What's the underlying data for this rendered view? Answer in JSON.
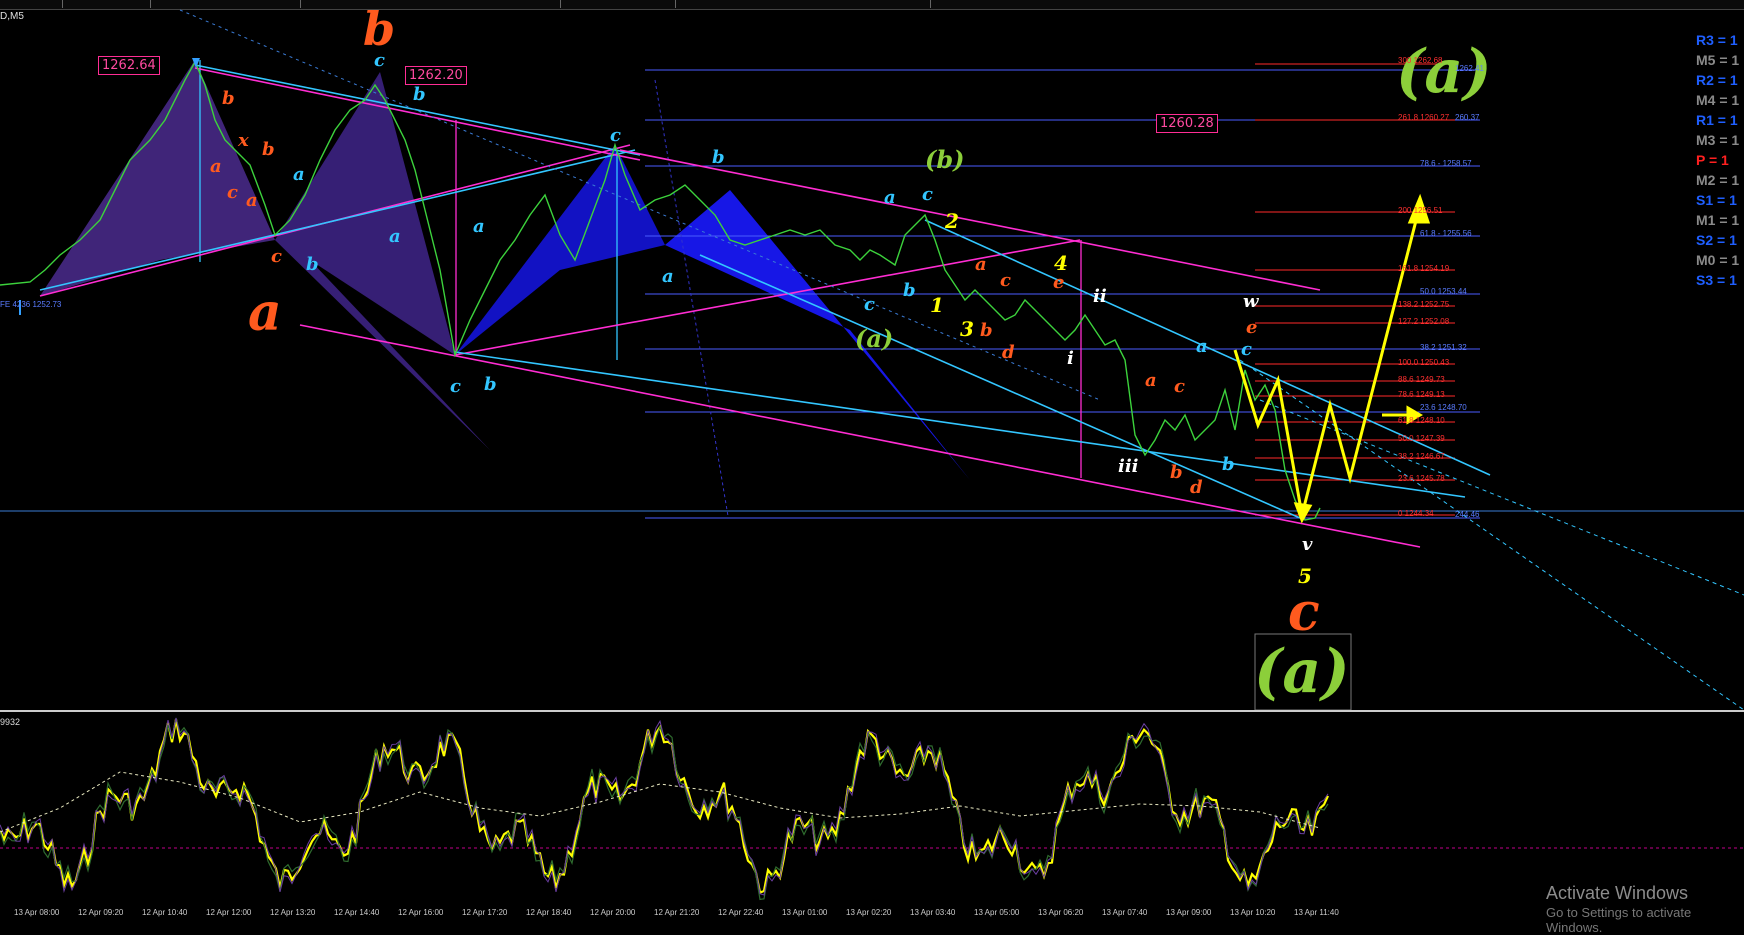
{
  "chart_title": "D,M5",
  "pivots": [
    {
      "label": "R3 = 1",
      "color": "#1f5fff"
    },
    {
      "label": "M5 = 1",
      "color": "#8a8a8a"
    },
    {
      "label": "R2 = 1",
      "color": "#1f5fff"
    },
    {
      "label": "M4 = 1",
      "color": "#8a8a8a"
    },
    {
      "label": "R1 = 1",
      "color": "#1f5fff"
    },
    {
      "label": "M3 = 1",
      "color": "#8a8a8a"
    },
    {
      "label": "P = 1",
      "color": "#ff2020"
    },
    {
      "label": "M2 = 1",
      "color": "#8a8a8a"
    },
    {
      "label": "S1 = 1",
      "color": "#1f5fff"
    },
    {
      "label": "M1 = 1",
      "color": "#8a8a8a"
    },
    {
      "label": "S2 = 1",
      "color": "#1f5fff"
    },
    {
      "label": "M0 = 1",
      "color": "#8a8a8a"
    },
    {
      "label": "S3 = 1",
      "color": "#1f5fff"
    }
  ],
  "price_boxes": {
    "high_left": "1262.64",
    "high_mid": "1262.20",
    "target": "1260.28"
  },
  "fe_label": "FE 4236 1252.73",
  "fib_blue": [
    {
      "text": "1262.41",
      "color": "#5a7cff"
    },
    {
      "text": "260.37",
      "color": "#5a7cff"
    },
    {
      "text": "78.6 - 1258.57",
      "color": "#5a7cff"
    },
    {
      "text": "61.8 - 1255.56",
      "color": "#5a7cff"
    },
    {
      "text": "50.0 1253.44",
      "color": "#5a7cff"
    },
    {
      "text": "38.2 1251.32",
      "color": "#5a7cff"
    },
    {
      "text": "23.6 1248.70",
      "color": "#5a7cff"
    },
    {
      "text": "244.46",
      "color": "#5a7cff"
    }
  ],
  "fib_red": [
    {
      "text": "300 1262.68",
      "color": "#ff3030"
    },
    {
      "text": "261.8 1260.27",
      "color": "#ff3030"
    },
    {
      "text": "200 1256.51",
      "color": "#ff3030"
    },
    {
      "text": "161.8 1254.19",
      "color": "#ff3030"
    },
    {
      "text": "138.2 1252.75",
      "color": "#ff3030"
    },
    {
      "text": "127.2 1252.08",
      "color": "#ff3030"
    },
    {
      "text": "100.0 1250.43",
      "color": "#ff3030"
    },
    {
      "text": "88.6 1249.73",
      "color": "#ff3030"
    },
    {
      "text": "78.6 1249.13",
      "color": "#ff3030"
    },
    {
      "text": "61.8 1248.10",
      "color": "#ff3030"
    },
    {
      "text": "50.0 1247.39",
      "color": "#ff3030"
    },
    {
      "text": "38.2 1246.67",
      "color": "#ff3030"
    },
    {
      "text": "23.6 1245.78",
      "color": "#ff3030"
    },
    {
      "text": "0 1244.34",
      "color": "#ff3030"
    }
  ],
  "wave_labels": {
    "big_b": "b",
    "big_a": "a",
    "big_c": "c",
    "circ_a_top": "(a)",
    "circ_a_bottom": "(a)",
    "circ_b": "(b)",
    "sub_a": "(a)",
    "n1": "1",
    "n2": "2",
    "n3": "3",
    "n4": "4",
    "n5": "5",
    "r_i": "i",
    "r_ii": "ii",
    "r_iii": "iii",
    "r_w": "w",
    "r_v": "v",
    "a": "a",
    "b": "b",
    "c": "c",
    "d": "d",
    "e": "e",
    "x": "x"
  },
  "indicator_label": "9932",
  "time_labels": [
    "13 Apr 08:00",
    "12 Apr 09:20",
    "12 Apr 10:40",
    "12 Apr 12:00",
    "12 Apr 13:20",
    "12 Apr 14:40",
    "12 Apr 16:00",
    "12 Apr 17:20",
    "12 Apr 18:40",
    "12 Apr 20:00",
    "12 Apr 21:20",
    "12 Apr 22:40",
    "13 Apr 01:00",
    "13 Apr 02:20",
    "13 Apr 03:40",
    "13 Apr 05:00",
    "13 Apr 06:20",
    "13 Apr 07:40",
    "13 Apr 09:00",
    "13 Apr 10:20",
    "13 Apr 11:40"
  ],
  "watermark": {
    "title": "Activate Windows",
    "subtitle": "Go to Settings to activate Windows."
  },
  "colors": {
    "price": "#3cd23c",
    "oscillator": "#ffff00",
    "pink": "#ff2dd2",
    "cyan": "#33c6ff",
    "yellow": "#ffff00",
    "orange": "#ff5a1e"
  }
}
